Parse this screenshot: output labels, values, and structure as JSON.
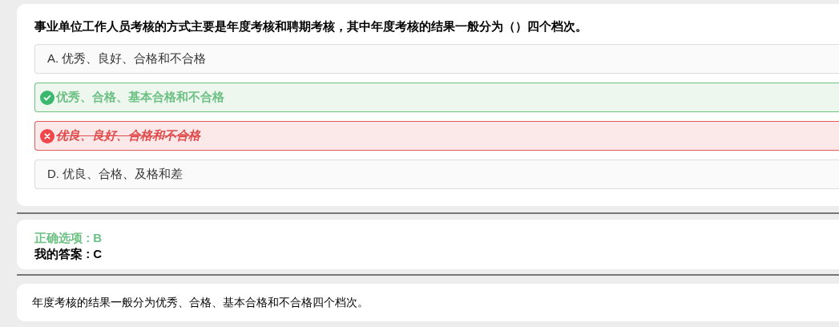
{
  "question": "事业单位工作人员考核的方式主要是年度考核和聘期考核，其中年度考核的结果一般分为（）四个档次。",
  "options": [
    {
      "kind": "normal",
      "text": "A. 优秀、良好、合格和不合格"
    },
    {
      "kind": "correct",
      "text": "优秀、合格、基本合格和不合格"
    },
    {
      "kind": "wrong",
      "text": "优良、良好、合格和不合格"
    },
    {
      "kind": "normal",
      "text": "D. 优良、合格、及格和差"
    }
  ],
  "result": {
    "correct_answer": "正确选项 : B",
    "my_answer": "我的答案 : C"
  },
  "explanation": "年度考核的结果一般分为优秀、合格、基本合格和不合格四个档次。"
}
